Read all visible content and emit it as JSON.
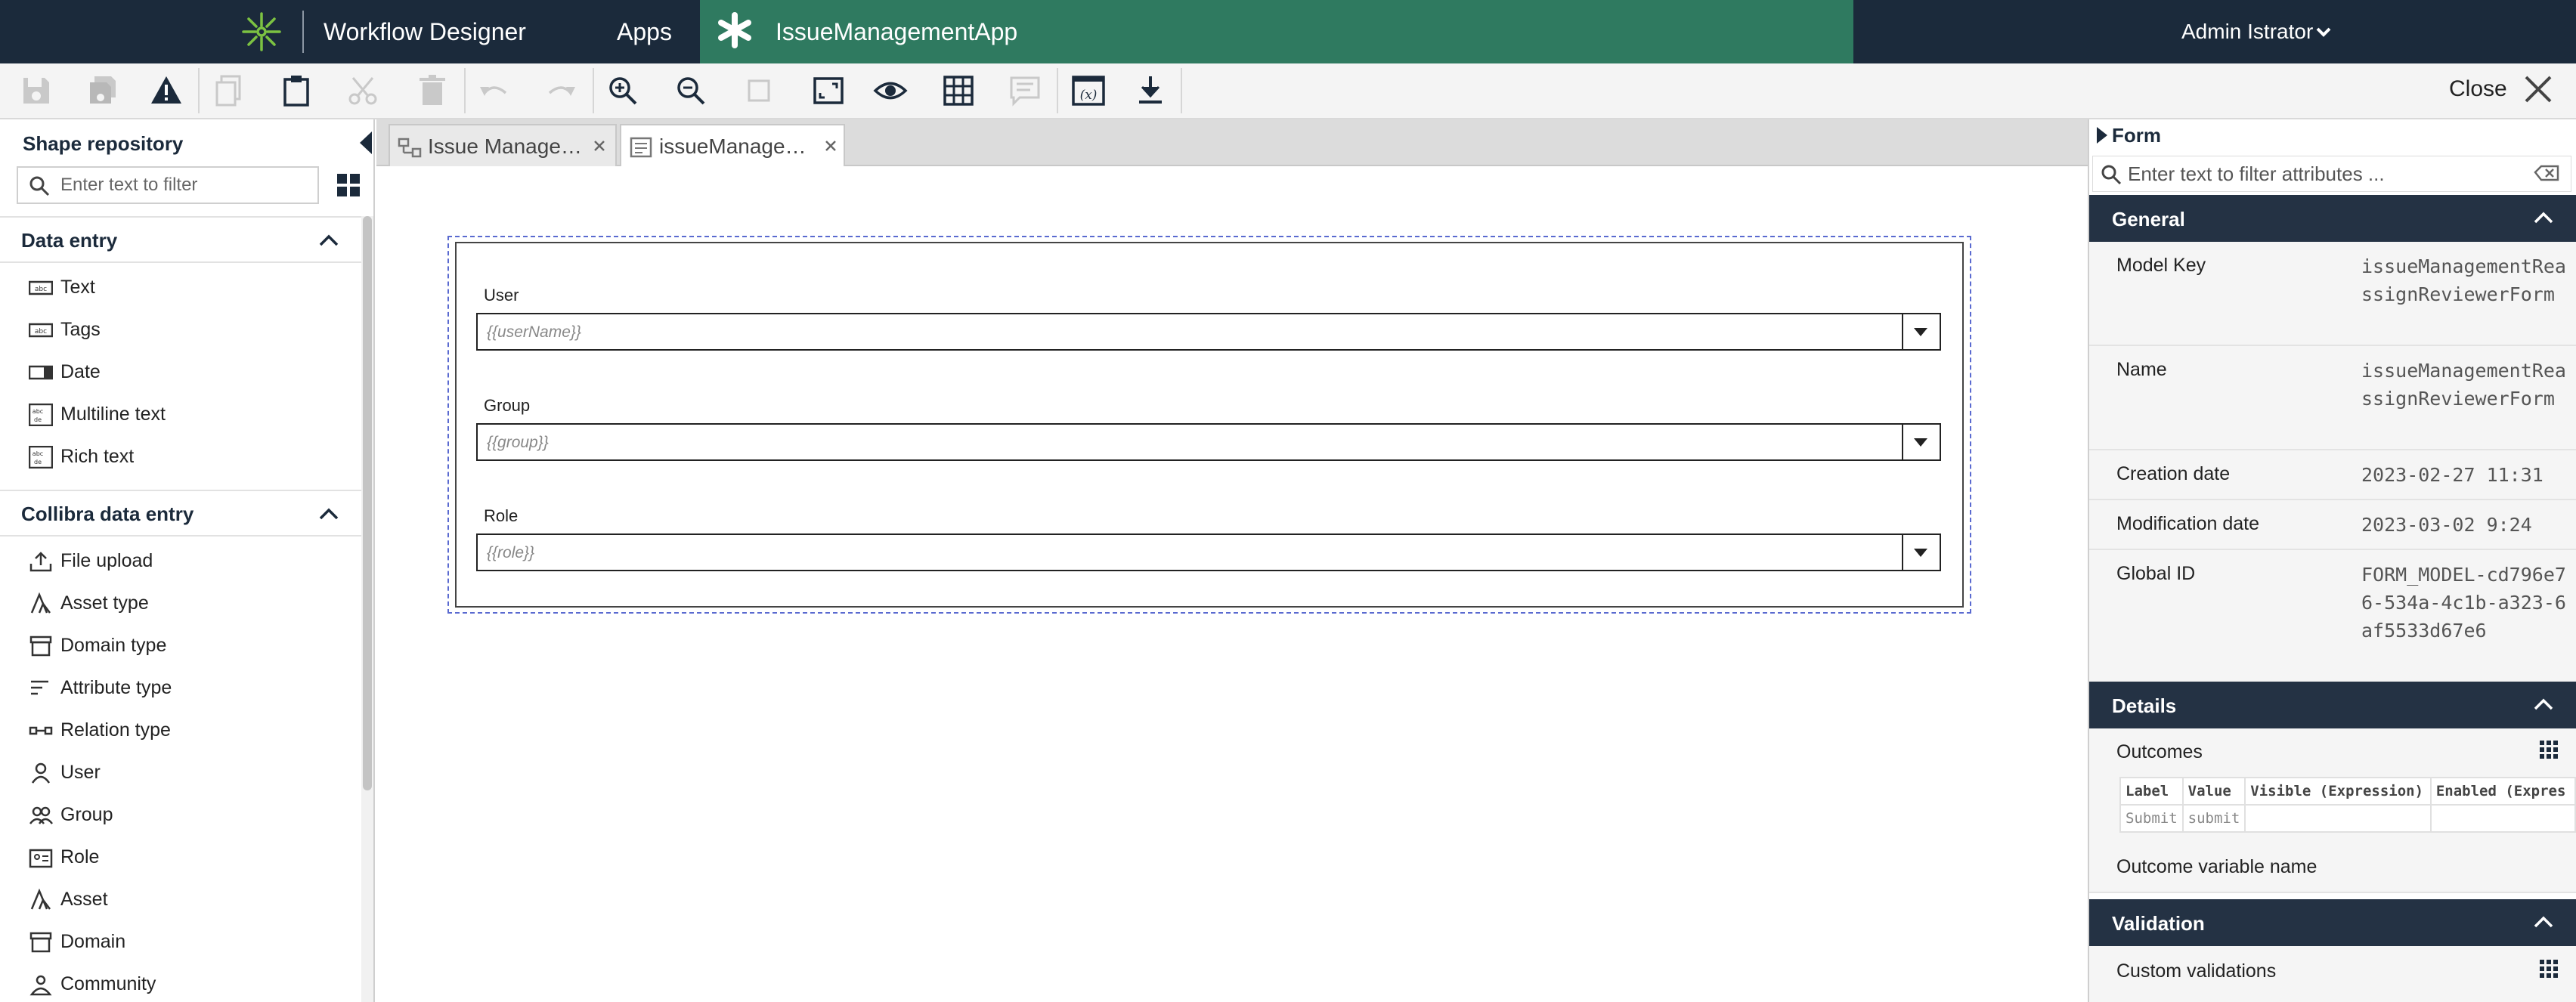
{
  "topbar": {
    "title": "Workflow Designer",
    "apps_label": "Apps",
    "app_name": "IssueManagementApp",
    "user_name": "Admin Istrator",
    "brand_color": "#1b2a3b",
    "app_tab_color": "#2f7a60",
    "logo_color": "#7cc242"
  },
  "toolbar": {
    "buttons": [
      "save-icon",
      "save-copy-icon",
      "validate-warning-icon",
      "copy-icon",
      "paste-icon",
      "cut-icon",
      "delete-icon",
      "undo-icon",
      "redo-icon",
      "zoom-in-icon",
      "zoom-out-icon",
      "zoom-actual-icon",
      "zoom-fit-icon",
      "preview-eye-icon",
      "table-grid-icon",
      "comment-icon",
      "variables-icon",
      "download-icon"
    ],
    "close_label": "Close"
  },
  "shape_repository": {
    "title": "Shape repository",
    "filter_placeholder": "Enter text to filter",
    "sections": [
      {
        "title": "Data entry",
        "items": [
          {
            "label": "Text",
            "icon": "text-field-icon"
          },
          {
            "label": "Tags",
            "icon": "tags-field-icon"
          },
          {
            "label": "Date",
            "icon": "date-field-icon"
          },
          {
            "label": "Multiline text",
            "icon": "multiline-text-icon"
          },
          {
            "label": "Rich text",
            "icon": "rich-text-icon"
          }
        ]
      },
      {
        "title": "Collibra data entry",
        "items": [
          {
            "label": "File upload",
            "icon": "upload-icon"
          },
          {
            "label": "Asset type",
            "icon": "asset-type-icon"
          },
          {
            "label": "Domain type",
            "icon": "domain-type-icon"
          },
          {
            "label": "Attribute type",
            "icon": "attribute-type-icon"
          },
          {
            "label": "Relation type",
            "icon": "relation-type-icon"
          },
          {
            "label": "User",
            "icon": "user-icon"
          },
          {
            "label": "Group",
            "icon": "group-icon"
          },
          {
            "label": "Role",
            "icon": "role-icon"
          },
          {
            "label": "Asset",
            "icon": "asset-icon"
          },
          {
            "label": "Domain",
            "icon": "domain-icon"
          },
          {
            "label": "Community",
            "icon": "community-icon"
          }
        ]
      }
    ]
  },
  "editor_tabs": [
    {
      "label": "Issue Manage…",
      "icon": "process-model-icon",
      "active": false
    },
    {
      "label": "issueManage…",
      "icon": "form-model-icon",
      "active": true
    }
  ],
  "form": {
    "fields": [
      {
        "label": "User",
        "placeholder": "{{userName}}"
      },
      {
        "label": "Group",
        "placeholder": "{{group}}"
      },
      {
        "label": "Role",
        "placeholder": "{{role}}"
      }
    ]
  },
  "properties": {
    "title": "Form",
    "filter_placeholder": "Enter text to filter attributes ...",
    "general": {
      "title": "General",
      "rows": [
        {
          "key": "Model Key",
          "value": "issueManagementReassignReviewerForm"
        },
        {
          "key": "Name",
          "value": "issueManagementReassignReviewerForm"
        },
        {
          "key": "Creation date",
          "value": "2023-02-27 11:31"
        },
        {
          "key": "Modification date",
          "value": "2023-03-02 9:24"
        },
        {
          "key": "Global ID",
          "value": "FORM_MODEL-cd796e76-534a-4c1b-a323-6af5533d67e6"
        }
      ]
    },
    "details": {
      "title": "Details",
      "outcomes_label": "Outcomes",
      "outcomes_columns": [
        "Label",
        "Value",
        "Visible (Expression)",
        "Enabled (Expres"
      ],
      "outcomes_rows": [
        [
          "Submit",
          "submit",
          "",
          ""
        ]
      ],
      "outcome_variable_label": "Outcome variable name"
    },
    "validation": {
      "title": "Validation",
      "custom_validations_label": "Custom validations"
    }
  }
}
